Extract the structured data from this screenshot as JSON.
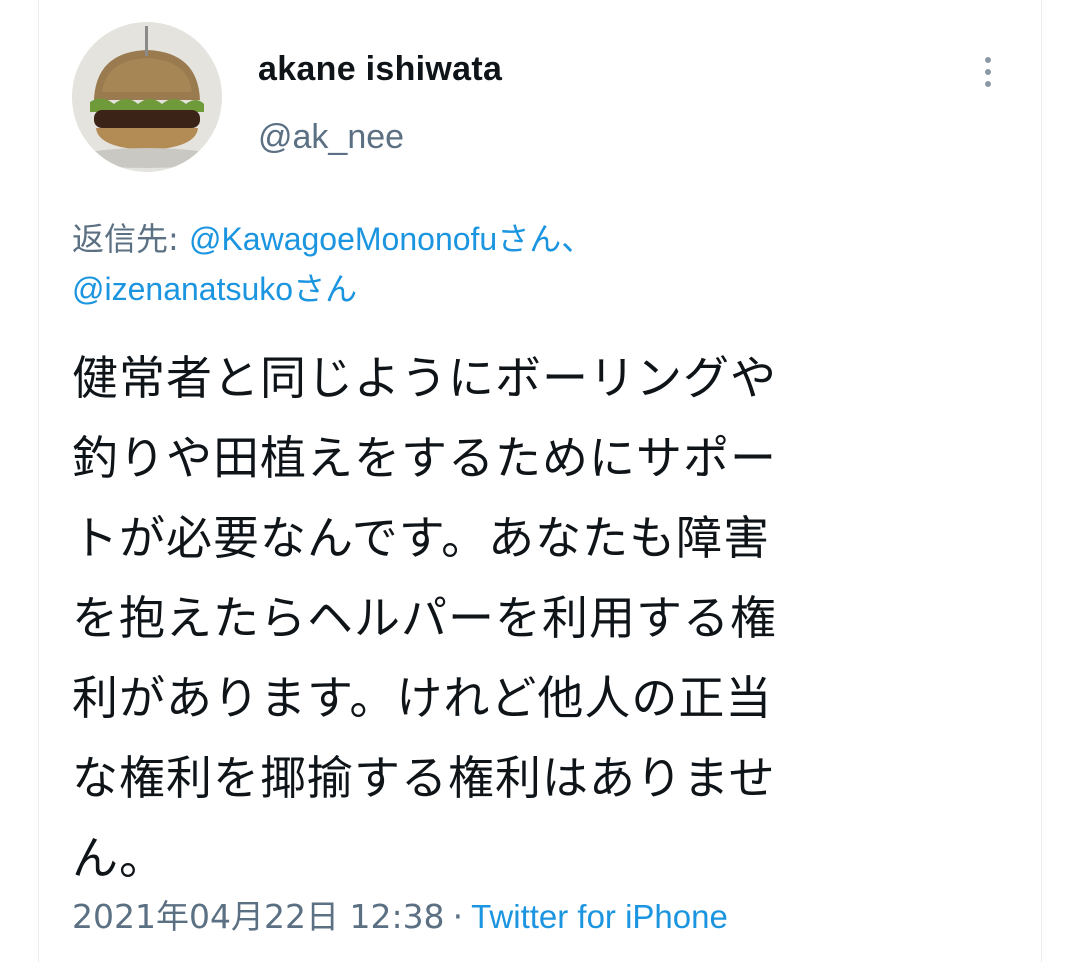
{
  "tweet": {
    "author": {
      "display_name": "akane ishiwata",
      "handle": "@ak_nee",
      "avatar_icon": "hamburger-avatar-icon"
    },
    "reply": {
      "prefix": "返信先: ",
      "mention1": "@KawagoeMononofu",
      "suffix1": "さん、",
      "mention2": "@izenanatsuko",
      "suffix2": "さん"
    },
    "text_lines": [
      "健常者と同じようにボーリングや",
      "釣りや田植えをするためにサポー",
      "トが必要なんです。あなたも障害",
      "を抱えたらヘルパーを利用する権",
      "利があります。けれど他人の正当",
      "な権利を揶揄する権利はありませ",
      "ん。"
    ],
    "timestamp": "2021年04月22日 12:38",
    "separator": "·",
    "source": "Twitter for iPhone"
  },
  "colors": {
    "text": "#0f1419",
    "secondary": "#5b7083",
    "link": "#1b95e0"
  }
}
